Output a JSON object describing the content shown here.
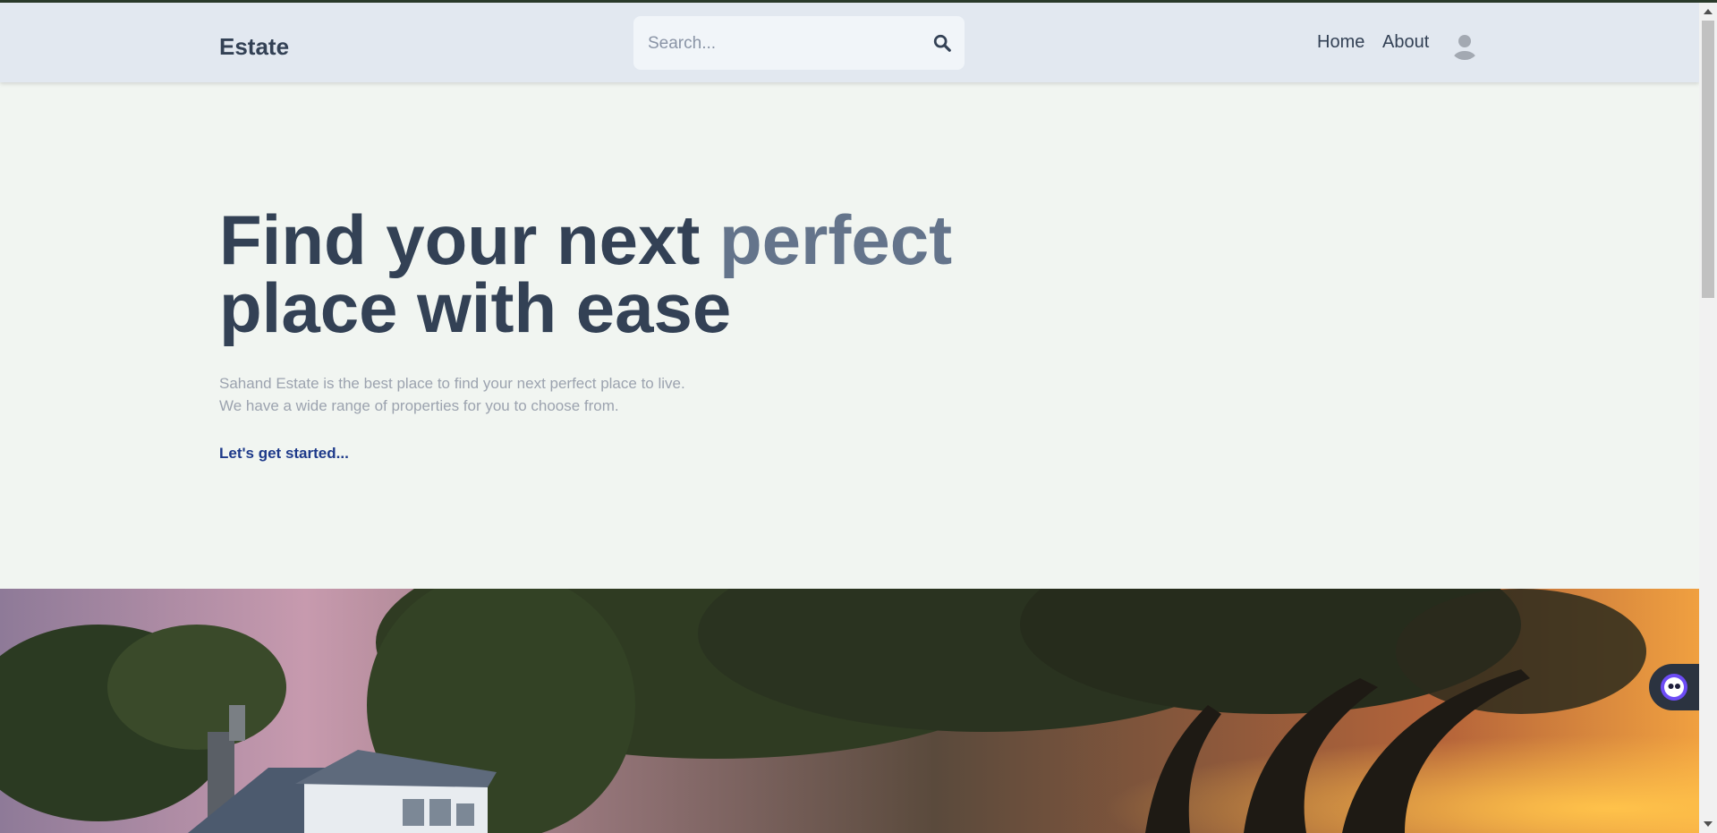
{
  "header": {
    "logo": "Estate",
    "search": {
      "placeholder": "Search...",
      "value": ""
    },
    "nav": {
      "home": "Home",
      "about": "About"
    }
  },
  "hero": {
    "title_part1": "Find your next ",
    "title_accent": "perfect",
    "title_part2": "place with ease",
    "description_line1": "Sahand Estate is the best place to find your next perfect place to live.",
    "description_line2": "We have a wide range of properties for you to choose from.",
    "cta": "Let's get started..."
  },
  "icons": {
    "search": "search-icon",
    "avatar": "user-avatar-icon",
    "chat": "chat-bot-icon",
    "scroll_up": "arrow-up-icon",
    "scroll_down": "arrow-down-icon"
  },
  "colors": {
    "header_bg": "#e2e8f0",
    "page_bg": "#f1f5f1",
    "text_dark": "#334155",
    "accent_text": "#64748b",
    "muted_text": "#9ca3af",
    "cta": "#1e3a8a"
  }
}
